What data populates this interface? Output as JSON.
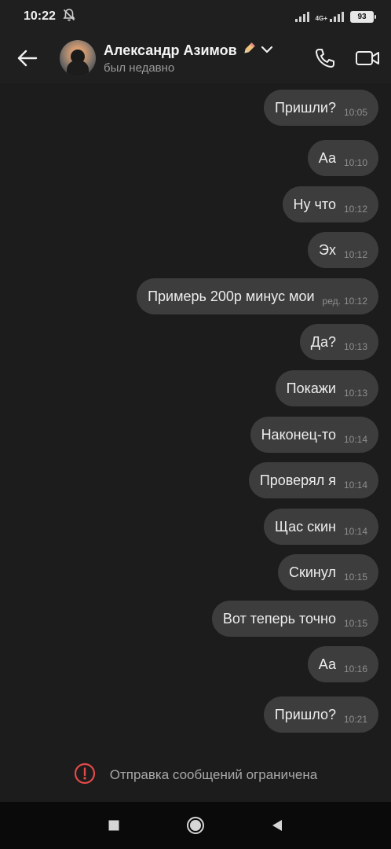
{
  "status_bar": {
    "time": "10:22",
    "network": "4G+",
    "battery": "93"
  },
  "header": {
    "contact_name": "Александр Азимов",
    "contact_status": "был недавно"
  },
  "messages": [
    {
      "text": "Пришли?",
      "time": "10:05"
    },
    {
      "text": "Аа",
      "time": "10:10"
    },
    {
      "text": "Ну что",
      "time": "10:12"
    },
    {
      "text": "Эх",
      "time": "10:12"
    },
    {
      "text": "Примерь 200р минус мои",
      "edited": "ред.",
      "time": "10:12"
    },
    {
      "text": "Да?",
      "time": "10:13"
    },
    {
      "text": "Покажи",
      "time": "10:13"
    },
    {
      "text": "Наконец-то",
      "time": "10:14"
    },
    {
      "text": "Проверял я",
      "time": "10:14"
    },
    {
      "text": "Щас скин",
      "time": "10:14"
    },
    {
      "text": "Скинул",
      "time": "10:15"
    },
    {
      "text": "Вот теперь точно",
      "time": "10:15"
    },
    {
      "text": "Аа",
      "time": "10:16"
    },
    {
      "text": "Пришло?",
      "time": "10:21"
    }
  ],
  "restriction": {
    "text": "Отправка сообщений ограничена",
    "color": "#e24a4a"
  },
  "icons": {
    "back": "arrow-left-icon",
    "call": "phone-icon",
    "video": "video-camera-icon",
    "dropdown": "chevron-down-icon",
    "emoji": "pencil-emoji-icon",
    "alert": "exclamation-circle-icon",
    "nav_recents": "square-icon",
    "nav_home": "circle-icon",
    "nav_back": "triangle-back-icon"
  }
}
